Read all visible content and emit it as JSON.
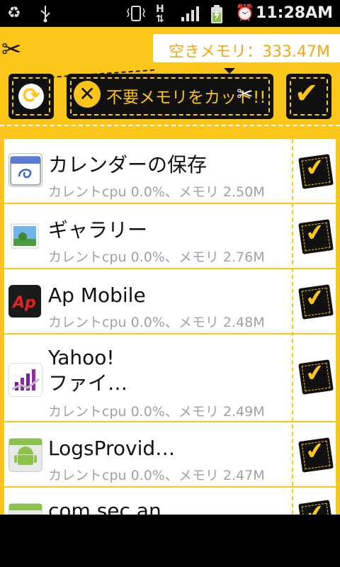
{
  "status": {
    "time": "11:28AM",
    "icons": [
      "recycle-icon",
      "usb-icon",
      "vibrate-icon",
      "hplus-data-icon",
      "signal-icon",
      "battery-charging-icon",
      "alarm-icon"
    ]
  },
  "header": {
    "memory_label": "空きメモリ：333.47M",
    "cut_label": "不要メモリをカット!!"
  },
  "apps": [
    {
      "name": "カレンダーの保存",
      "sub": "カレントcpu 0.0%、メモリ 2.50M",
      "icon": "calendar-icon",
      "checked": true
    },
    {
      "name": "ギャラリー",
      "sub": "カレントcpu 0.0%、メモリ 2.76M",
      "icon": "gallery-icon",
      "checked": true
    },
    {
      "name": "Ap Mobile",
      "sub": "カレントcpu 0.0%、メモリ 2.48M",
      "icon": "ap-mobile-icon",
      "checked": true
    },
    {
      "name": "Yahoo!",
      "name2": "ファイ…",
      "sub": "カレントcpu 0.0%、メモリ 2.49M",
      "icon": "yahoo-finance-icon",
      "checked": true
    },
    {
      "name": "LogsProvid…",
      "sub": "カレントcpu 0.0%、メモリ 2.47M",
      "icon": "android-icon",
      "checked": true
    },
    {
      "name": "com.sec.an…",
      "sub": "",
      "icon": "android-icon",
      "checked": true
    }
  ],
  "colors": {
    "accent": "#fbc51a",
    "dark": "#111111",
    "subtext": "#a0a0a0"
  }
}
